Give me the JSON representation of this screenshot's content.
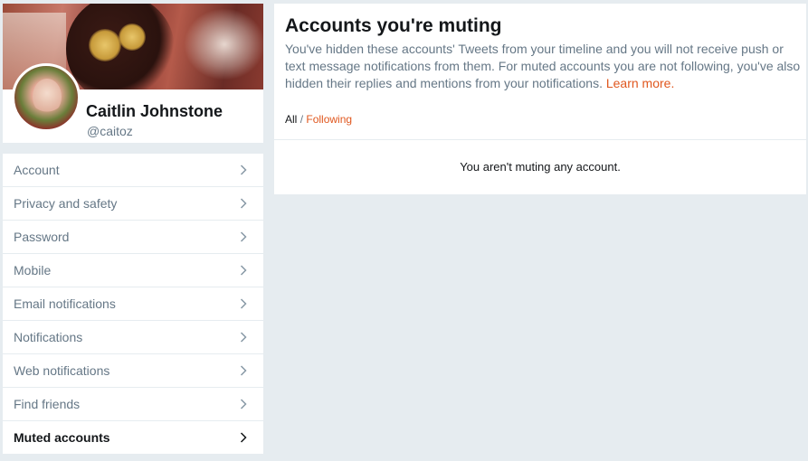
{
  "profile": {
    "name": "Caitlin Johnstone",
    "handle": "@caitoz"
  },
  "nav": {
    "items": [
      {
        "label": "Account",
        "icon": "chevron-right-icon",
        "active": false
      },
      {
        "label": "Privacy and safety",
        "icon": "chevron-right-icon",
        "active": false
      },
      {
        "label": "Password",
        "icon": "chevron-right-icon",
        "active": false
      },
      {
        "label": "Mobile",
        "icon": "chevron-right-icon",
        "active": false
      },
      {
        "label": "Email notifications",
        "icon": "chevron-right-icon",
        "active": false
      },
      {
        "label": "Notifications",
        "icon": "chevron-right-icon",
        "active": false
      },
      {
        "label": "Web notifications",
        "icon": "chevron-right-icon",
        "active": false
      },
      {
        "label": "Find friends",
        "icon": "chevron-right-icon",
        "active": false
      },
      {
        "label": "Muted accounts",
        "icon": "chevron-right-icon",
        "active": true
      }
    ]
  },
  "main": {
    "title": "Accounts you're muting",
    "description": "You've hidden these accounts' Tweets from your timeline and you will not receive push or text message notifications from them. For muted accounts you are not following, you've also hidden their replies and mentions from your notifications.",
    "learn_more": "Learn more.",
    "filters": {
      "all": "All",
      "separator": "/",
      "following": "Following"
    },
    "empty_message": "You aren't muting any account."
  },
  "colors": {
    "accent": "#e0571e",
    "background": "#e6ecf0",
    "text_secondary": "#657786"
  }
}
